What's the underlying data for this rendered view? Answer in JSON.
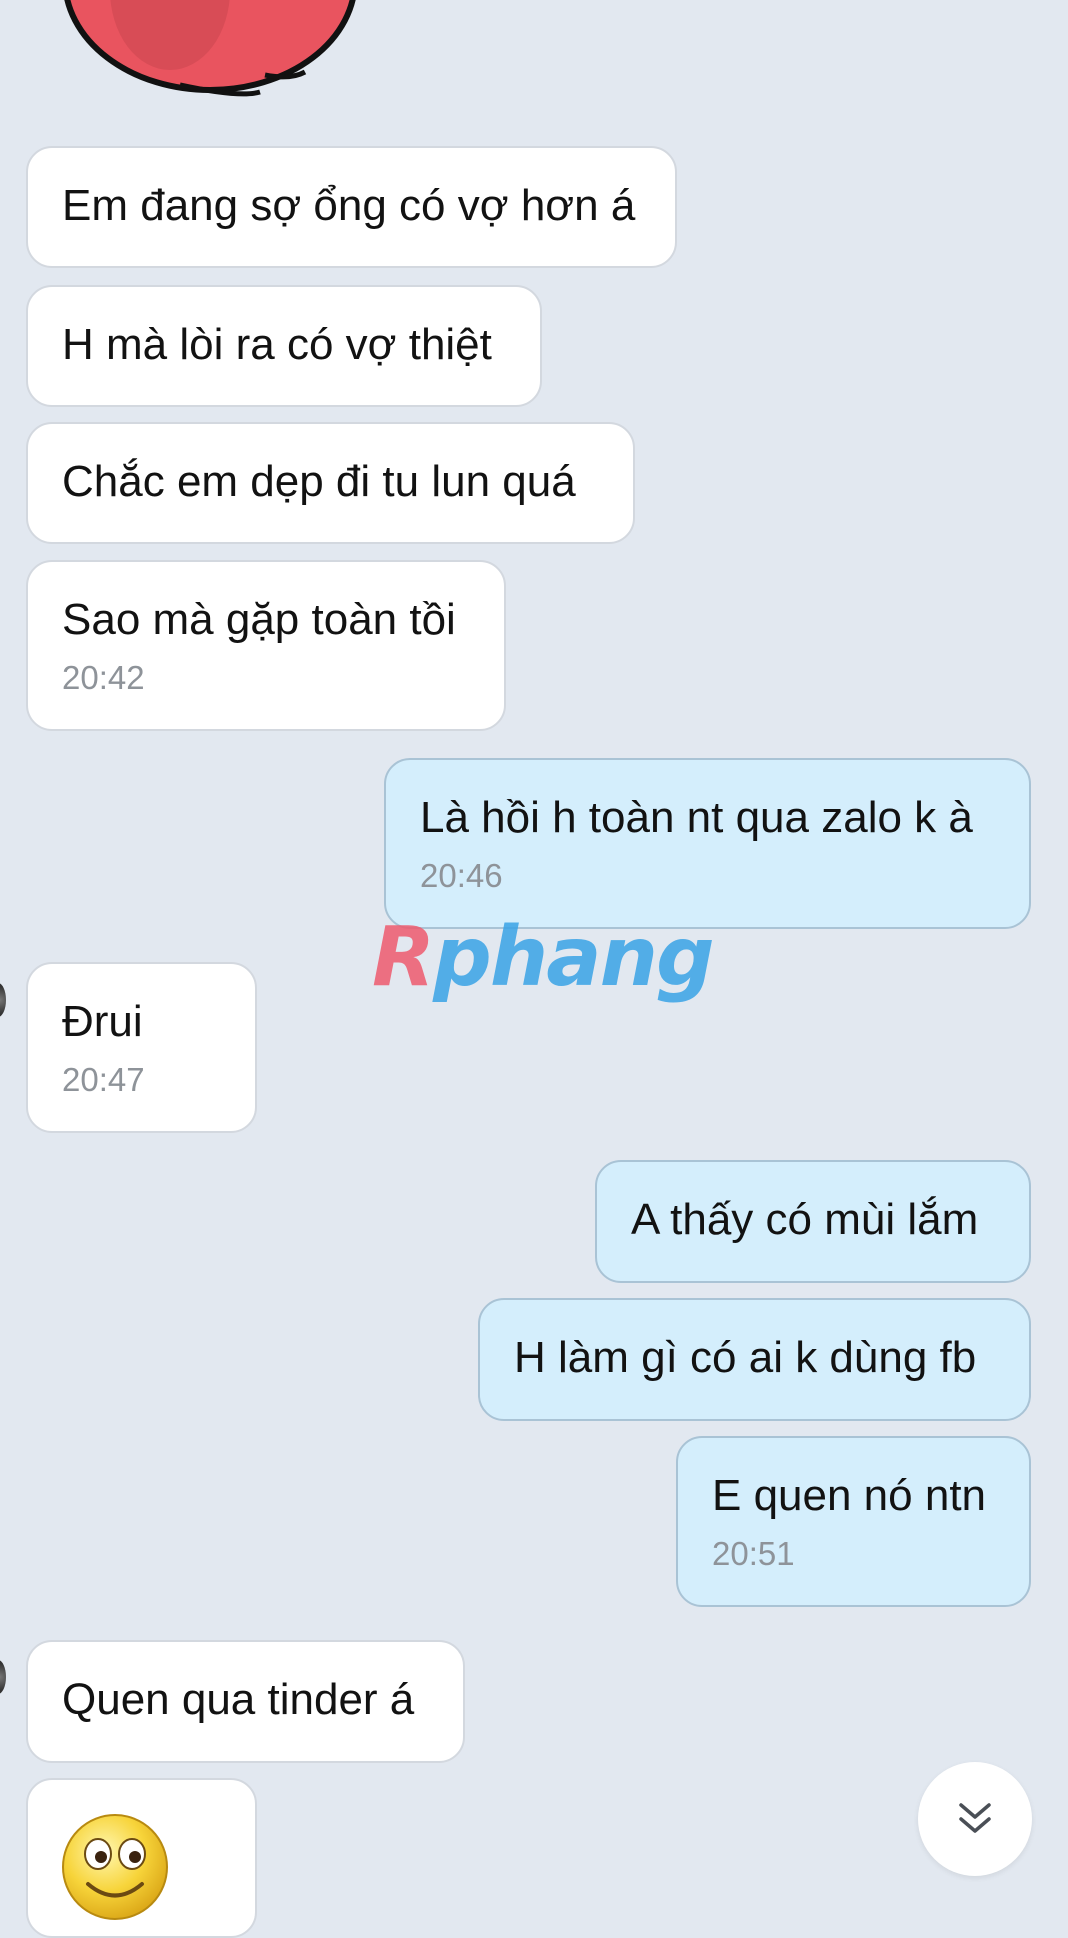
{
  "messages": [
    {
      "dir": "in",
      "text": "Em đang sợ ổng có vợ hơn á",
      "time": null
    },
    {
      "dir": "in",
      "text": "H mà lòi ra có vợ thiệt",
      "time": null
    },
    {
      "dir": "in",
      "text": "Chắc em dẹp đi tu lun quá",
      "time": null
    },
    {
      "dir": "in",
      "text": "Sao mà gặp toàn tồi",
      "time": "20:42"
    },
    {
      "dir": "out",
      "text": "Là hồi h toàn nt qua zalo k à",
      "time": "20:46"
    },
    {
      "dir": "in",
      "text": "Đrui",
      "time": "20:47"
    },
    {
      "dir": "out",
      "text": "A thấy có mùi lắm",
      "time": null
    },
    {
      "dir": "out",
      "text": "H làm gì có ai k dùng fb",
      "time": null
    },
    {
      "dir": "out",
      "text": "E quen nó ntn",
      "time": "20:51"
    },
    {
      "dir": "in",
      "text": "Quen qua tinder á",
      "time": null
    }
  ],
  "watermark": {
    "first": "R",
    "rest": "phang"
  },
  "icons": {
    "sticker_top": "red-heart-sticker-icon",
    "sticker_bottom": "smiley-face-icon",
    "scroll_button": "double-chevron-down-icon"
  },
  "colors": {
    "background": "#e2e8f0",
    "incoming_bubble": "#ffffff",
    "outgoing_bubble": "#d4eefc",
    "time_text": "#8e9399"
  }
}
